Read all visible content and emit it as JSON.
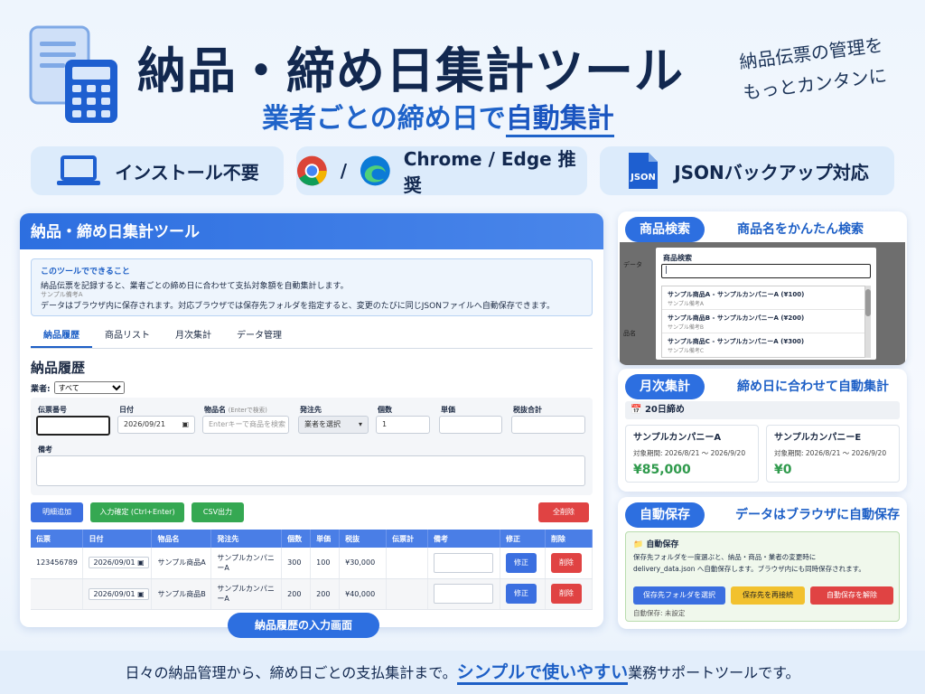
{
  "header": {
    "title": "納品・締め日集計ツール",
    "subtitle_pre": "業者ごとの締め日で",
    "subtitle_hl": "自動集計",
    "handwritten_1": "納品伝票の管理を",
    "handwritten_2": "もっとカンタンに"
  },
  "features": {
    "install": "インストール不要",
    "browser_sep": "/",
    "browser": "Chrome / Edge 推奨",
    "json_icon": "JSON",
    "json": "JSONバックアップ対応"
  },
  "app": {
    "title": "納品・締め日集計ツール",
    "info_title": "このツールでできること",
    "info_line1": "納品伝票を記録すると、業者ごとの締め日に合わせて支払対象額を自動集計します。",
    "info_line2": "サンプル備考A",
    "info_line3": "データはブラウザ内に保存されます。対応ブラウザでは保存先フォルダを指定すると、変更のたびに同じJSONファイルへ自動保存できます。",
    "tabs": [
      "納品履歴",
      "商品リスト",
      "月次集計",
      "データ管理"
    ],
    "section_title": "納品履歴",
    "vendor_label": "業者:",
    "vendor_value": "すべて",
    "form": {
      "slip_label": "伝票番号",
      "date_label": "日付",
      "date_value": "2026/09/21",
      "product_label": "物品名",
      "product_hint": "(Enterで検索)",
      "product_placeholder": "Enterキーで商品を検索",
      "supplier_label": "発注先",
      "supplier_value": "業者を選択",
      "qty_label": "個数",
      "qty_value": "1",
      "price_label": "単価",
      "total_label": "税抜合計",
      "memo_label": "備考"
    },
    "buttons": {
      "add_row": "明細追加",
      "confirm": "入力確定 (Ctrl+Enter)",
      "csv": "CSV出力",
      "delete_all": "全削除"
    },
    "table": {
      "headers": [
        "伝票",
        "日付",
        "物品名",
        "発注先",
        "個数",
        "単価",
        "税抜",
        "伝票計",
        "備考",
        "修正",
        "削除"
      ],
      "rows": [
        {
          "slip": "123456789",
          "date": "2026/09/01",
          "product": "サンプル商品A",
          "supplier": "サンプルカンパニーA",
          "qty": "300",
          "price": "100",
          "subtotal": "¥30,000",
          "edit": "修正",
          "del": "削除"
        },
        {
          "slip": "",
          "date": "2026/09/01",
          "product": "サンプル商品B",
          "supplier": "サンプルカンパニーA",
          "qty": "200",
          "price": "200",
          "subtotal": "¥40,000",
          "edit": "修正",
          "del": "削除"
        }
      ]
    },
    "caption": "納品履歴の入力画面"
  },
  "search_card": {
    "pill": "商品検索",
    "title": "商品名をかんたん検索",
    "modal_label": "商品検索",
    "bg_label_1": "データ",
    "bg_label_2": "品名",
    "results": [
      {
        "name": "サンプル商品A - サンプルカンパニーA (¥100)",
        "memo": "サンプル備考A"
      },
      {
        "name": "サンプル商品B - サンプルカンパニーA (¥200)",
        "memo": "サンプル備考B"
      },
      {
        "name": "サンプル商品C - サンプルカンパニーA (¥300)",
        "memo": "サンプル備考C"
      }
    ]
  },
  "monthly_card": {
    "pill": "月次集計",
    "title": "締め日に合わせて自動集計",
    "closing": "20日締め",
    "vendors": [
      {
        "name": "サンプルカンパニーA",
        "period": "対象期間: 2026/8/21 〜 2026/9/20",
        "amount": "¥85,000"
      },
      {
        "name": "サンプルカンパニーE",
        "period": "対象期間: 2026/8/21 〜 2026/9/20",
        "amount": "¥0"
      }
    ]
  },
  "autosave_card": {
    "pill": "自動保存",
    "title": "データはブラウザに自動保存",
    "box_title": "自動保存",
    "line1": "保存先フォルダを一度選ぶと、納品・商品・業者の変更時に",
    "line2": "delivery_data.json へ自動保存します。ブラウザ内にも同時保存されます。",
    "btn_select": "保存先フォルダを選択",
    "btn_reconnect": "保存先を再接続",
    "btn_cancel": "自動保存を解除",
    "status": "自動保存: 未設定"
  },
  "footer": {
    "pre": "日々の納品管理から、締め日ごとの支払集計まで。",
    "hl": "シンプルで使いやすい",
    "post": "業務サポートツールです。"
  },
  "colors": {
    "primary": "#2d6fe0",
    "green": "#35a852",
    "red": "#e04343",
    "yellow": "#f2c12e",
    "navy": "#12284f"
  }
}
